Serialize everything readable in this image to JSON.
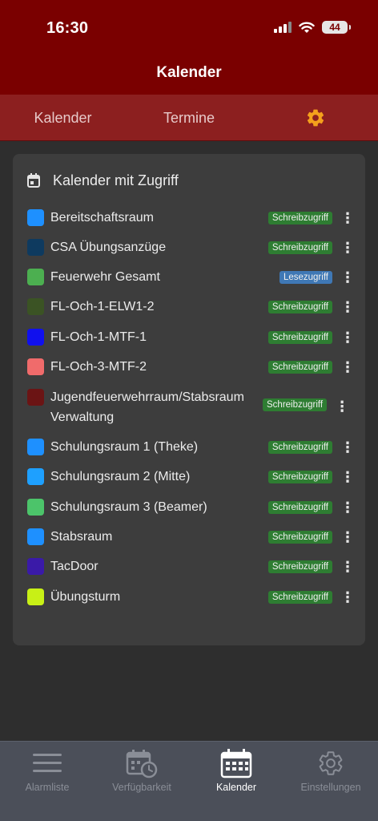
{
  "status": {
    "time": "16:30",
    "battery": "44"
  },
  "header": {
    "title": "Kalender"
  },
  "tabs": [
    {
      "label": "Kalender"
    },
    {
      "label": "Termine"
    },
    {
      "icon": "gear-icon",
      "color": "#f4a01c"
    }
  ],
  "card": {
    "title": "Kalender mit Zugriff",
    "calendars": [
      {
        "name": "Bereitschaftsraum",
        "color": "#1e90ff",
        "access": "Schreibzugriff"
      },
      {
        "name": "CSA Übungsanzüge",
        "color": "#0e3a5f",
        "access": "Schreibzugriff"
      },
      {
        "name": "Feuerwehr Gesamt",
        "color": "#4caf50",
        "access": "Lesezugriff"
      },
      {
        "name": "FL-Och-1-ELW1-2",
        "color": "#3b5324",
        "access": "Schreibzugriff"
      },
      {
        "name": "FL-Och-1-MTF-1",
        "color": "#1010ee",
        "access": "Schreibzugriff"
      },
      {
        "name": "FL-Och-3-MTF-2",
        "color": "#f06b6b",
        "access": "Schreibzugriff"
      },
      {
        "name": "Jugendfeuerwehrraum/Stabsraum Verwaltung",
        "color": "#6b1414",
        "access": "Schreibzugriff"
      },
      {
        "name": "Schulungsraum 1 (Theke)",
        "color": "#1e90ff",
        "access": "Schreibzugriff"
      },
      {
        "name": "Schulungsraum 2 (Mitte)",
        "color": "#1ea0ff",
        "access": "Schreibzugriff"
      },
      {
        "name": "Schulungsraum 3 (Beamer)",
        "color": "#4cc46a",
        "access": "Schreibzugriff"
      },
      {
        "name": "Stabsraum",
        "color": "#1e90ff",
        "access": "Schreibzugriff"
      },
      {
        "name": "TacDoor",
        "color": "#3a1aa8",
        "access": "Schreibzugriff"
      },
      {
        "name": "Übungsturm",
        "color": "#c8f016",
        "access": "Schreibzugriff"
      }
    ]
  },
  "nav": [
    {
      "label": "Alarmliste",
      "icon": "menu-icon"
    },
    {
      "label": "Verfügbarkeit",
      "icon": "calendar-clock-icon"
    },
    {
      "label": "Kalender",
      "icon": "calendar-icon",
      "active": true
    },
    {
      "label": "Einstellungen",
      "icon": "gear-icon"
    }
  ],
  "colors": {
    "header": "#7a0000",
    "tabbar": "#8c1f1f",
    "write_badge": "#2e7d32",
    "read_badge": "#3f78b5"
  }
}
